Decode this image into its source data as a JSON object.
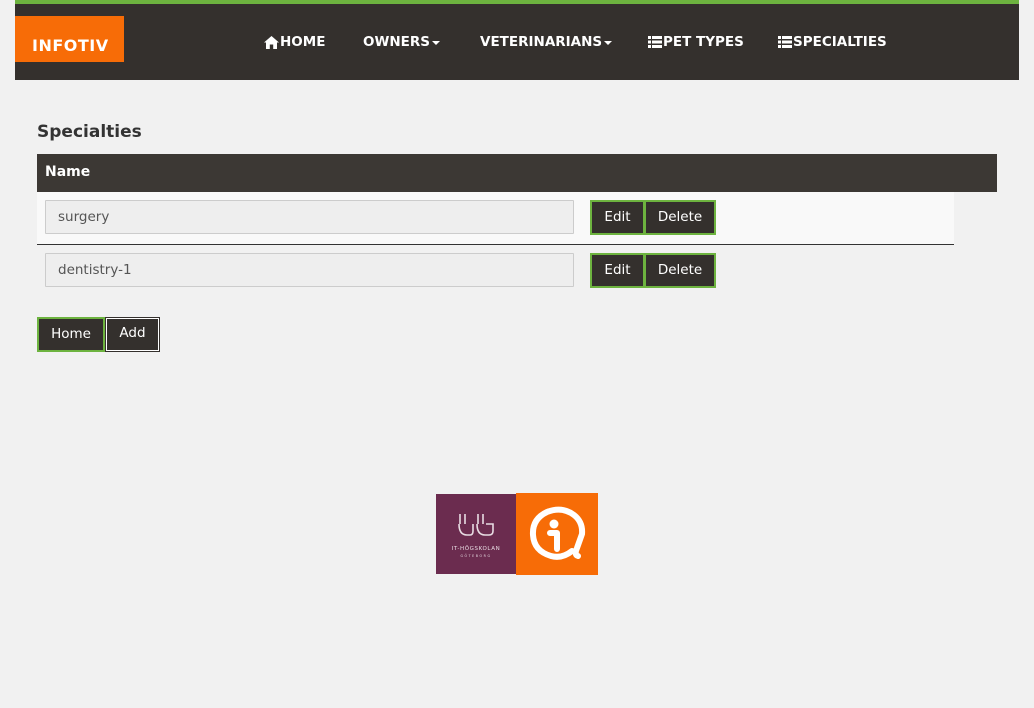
{
  "brand": {
    "name": "INFOTIV"
  },
  "nav": {
    "items": [
      {
        "label": "HOME",
        "icon": "home-icon",
        "has_caret": false
      },
      {
        "label": "OWNERS",
        "icon": null,
        "has_caret": true
      },
      {
        "label": "VETERINARIANS",
        "icon": null,
        "has_caret": true
      },
      {
        "label": "PET TYPES",
        "icon": "list-icon",
        "has_caret": false
      },
      {
        "label": "SPECIALTIES",
        "icon": "list-icon",
        "has_caret": false
      }
    ]
  },
  "page": {
    "title": "Specialties"
  },
  "table": {
    "columns": [
      "Name"
    ],
    "rows": [
      {
        "name": "surgery",
        "edit_label": "Edit",
        "delete_label": "Delete"
      },
      {
        "name": "dentistry-1",
        "edit_label": "Edit",
        "delete_label": "Delete"
      }
    ]
  },
  "actions": {
    "home_label": "Home",
    "add_label": "Add"
  },
  "footer": {
    "logos": [
      {
        "name": "IT-HÖGSKOLAN GÖTEBORG",
        "color": "#6b2c4f"
      },
      {
        "name": "INFOTIV",
        "color": "#f76c07"
      }
    ]
  },
  "colors": {
    "accent_green": "#6db33f",
    "navbar_dark": "#34302d",
    "brand_orange": "#f76c07",
    "background": "#f1f1f1"
  }
}
